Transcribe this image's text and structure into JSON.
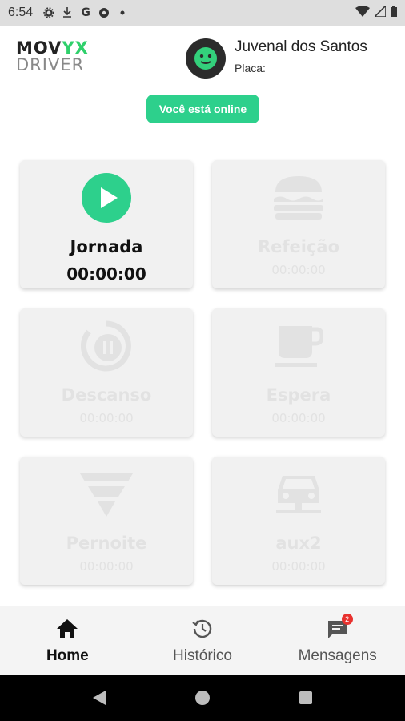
{
  "status_bar": {
    "time": "6:54",
    "icons": [
      "gear-icon",
      "download-icon",
      "google-icon",
      "soccer-icon",
      "dot-icon"
    ],
    "google_letter": "G",
    "right_icons": [
      "wifi-icon",
      "signal-icon",
      "battery-icon"
    ]
  },
  "header": {
    "logo_line1_a": "MOV",
    "logo_line1_b": "YX",
    "logo_line2": "DRIVER",
    "user_name": "Juvenal dos Santos",
    "plate_label": "Placa:",
    "online_status": "Você está online"
  },
  "cards": [
    {
      "id": "jornada",
      "title": "Jornada",
      "time": "00:00:00",
      "icon": "play-icon",
      "active": true
    },
    {
      "id": "refeicao",
      "title": "Refeição",
      "time": "00:00:00",
      "icon": "burger-icon",
      "active": false
    },
    {
      "id": "descanso",
      "title": "Descanso",
      "time": "00:00:00",
      "icon": "pause-circle-icon",
      "active": false
    },
    {
      "id": "espera",
      "title": "Espera",
      "time": "00:00:00",
      "icon": "coffee-cup-icon",
      "active": false
    },
    {
      "id": "pernoite",
      "title": "Pernoite",
      "time": "00:00:00",
      "icon": "funnel-icon",
      "active": false
    },
    {
      "id": "aux2",
      "title": "aux2",
      "time": "00:00:00",
      "icon": "car-icon",
      "active": false
    }
  ],
  "bottom_nav": {
    "items": [
      {
        "label": "Home",
        "icon": "home-icon",
        "active": true
      },
      {
        "label": "Histórico",
        "icon": "history-icon",
        "active": false
      },
      {
        "label": "Mensagens",
        "icon": "message-icon",
        "active": false,
        "badge": "2"
      }
    ]
  },
  "colors": {
    "accent_green": "#2dd08c",
    "status_bar_bg": "#dedede",
    "card_bg": "#f1f1f1",
    "inactive_text": "#e2e2e2",
    "badge_red": "#e8312e"
  }
}
